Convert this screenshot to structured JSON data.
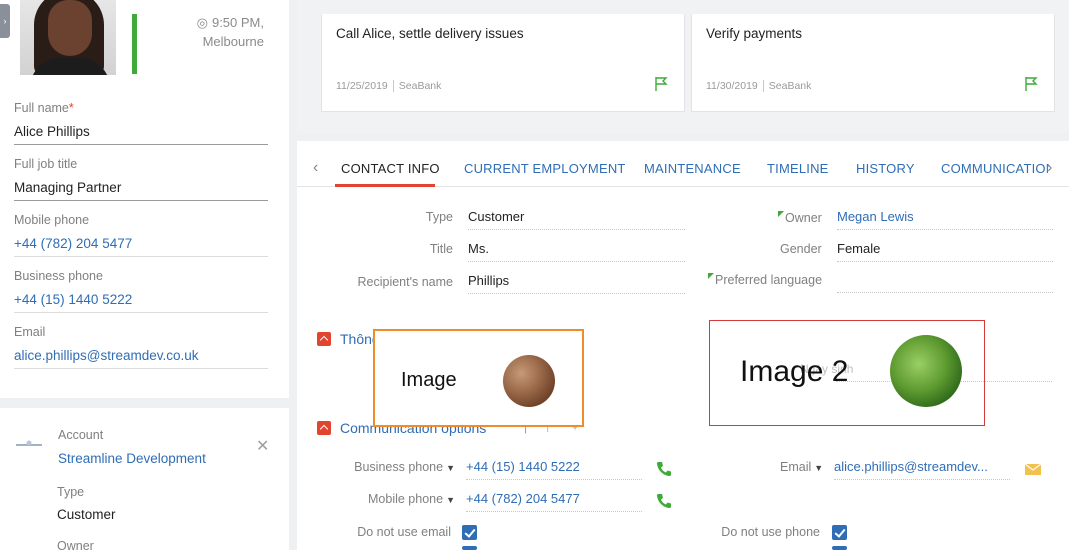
{
  "profile": {
    "time": "9:50 PM,",
    "city": "Melbourne",
    "fields": [
      {
        "label": "Full name",
        "value": "Alice Phillips",
        "required": true
      },
      {
        "label": "Full job title",
        "value": "Managing Partner"
      },
      {
        "label": "Mobile phone",
        "value": "+44 (782) 204 5477"
      },
      {
        "label": "Business phone",
        "value": "+44 (15) 1440 5222"
      },
      {
        "label": "Email",
        "value": "alice.phillips@streamdev.co.uk"
      }
    ]
  },
  "account": {
    "label": "Account",
    "name": "Streamline Development",
    "type_label": "Type",
    "type_value": "Customer",
    "owner_label": "Owner"
  },
  "tasks": [
    {
      "title": "Call Alice, settle delivery issues",
      "date": "11/25/2019",
      "source": "SeaBank"
    },
    {
      "title": "Verify payments",
      "date": "11/30/2019",
      "source": "SeaBank"
    }
  ],
  "tabs": [
    "CONTACT INFO",
    "CURRENT EMPLOYMENT",
    "MAINTENANCE",
    "TIMELINE",
    "HISTORY",
    "COMMUNICATION"
  ],
  "contact": {
    "type_label": "Type",
    "type_value": "Customer",
    "title_label": "Title",
    "title_value": "Ms.",
    "recipient_label": "Recipient's name",
    "recipient_value": "Phillips",
    "owner_label": "Owner",
    "owner_value": "Megan Lewis",
    "gender_label": "Gender",
    "gender_value": "Female",
    "language_label": "Preferred language",
    "language_value": ""
  },
  "sections": {
    "personal": "Thông tin nhân thân",
    "comm": "Communication options"
  },
  "overlays": {
    "image1": "Image",
    "image2": "Image 2",
    "ghost": "Ngày sinh"
  },
  "comm": {
    "business_label": "Business phone",
    "business_value": "+44 (15) 1440 5222",
    "mobile_label": "Mobile phone",
    "mobile_value": "+44 (782) 204 5477",
    "email_label": "Email",
    "email_value": "alice.phillips@streamdev...",
    "no_email_label": "Do not use email",
    "no_phone_label": "Do not use phone"
  },
  "colors": {
    "accent": "#e2442f",
    "link": "#2f6db5",
    "green": "#3faa3a"
  }
}
